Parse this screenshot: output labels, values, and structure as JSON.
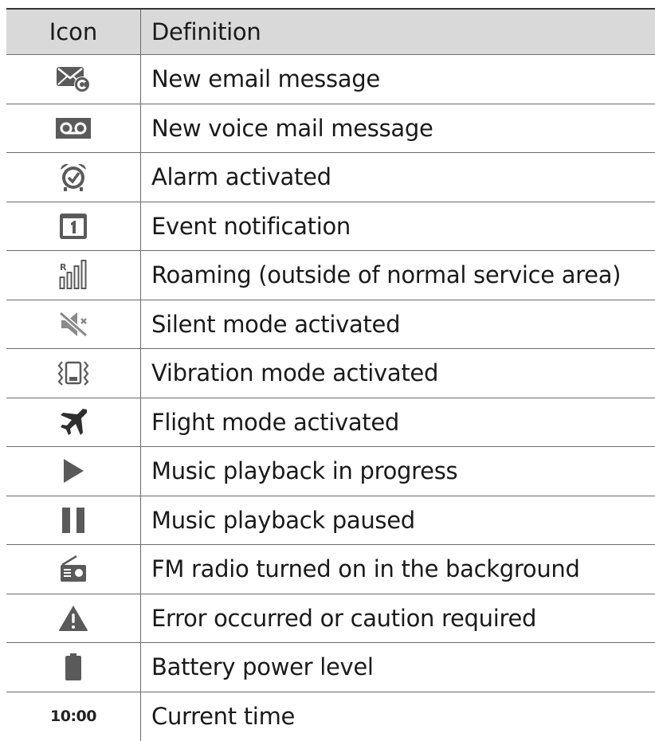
{
  "table": {
    "headers": {
      "icon": "Icon",
      "definition": "Definition"
    },
    "rows": [
      {
        "icon": "new-email-icon",
        "definition": "New email message"
      },
      {
        "icon": "voicemail-icon",
        "definition": "New voice mail message"
      },
      {
        "icon": "alarm-clock-icon",
        "definition": "Alarm activated"
      },
      {
        "icon": "calendar-icon",
        "definition": "Event notification"
      },
      {
        "icon": "roaming-signal-icon",
        "definition": "Roaming (outside of normal service area)"
      },
      {
        "icon": "silent-mode-icon",
        "definition": "Silent mode activated"
      },
      {
        "icon": "vibration-icon",
        "definition": "Vibration mode activated"
      },
      {
        "icon": "airplane-icon",
        "definition": "Flight mode activated"
      },
      {
        "icon": "play-icon",
        "definition": "Music playback in progress"
      },
      {
        "icon": "pause-icon",
        "definition": "Music playback paused"
      },
      {
        "icon": "fm-radio-icon",
        "definition": "FM radio turned on in the background"
      },
      {
        "icon": "warning-icon",
        "definition": "Error occurred or caution required"
      },
      {
        "icon": "battery-icon",
        "definition": "Battery power level"
      },
      {
        "icon": "time-text",
        "icon_text": "10:00",
        "definition": "Current time"
      }
    ]
  },
  "colors": {
    "header_bg": "#d9d9d9",
    "icon_gray": "#5a5a5a",
    "rule": "#6b6b6b"
  }
}
